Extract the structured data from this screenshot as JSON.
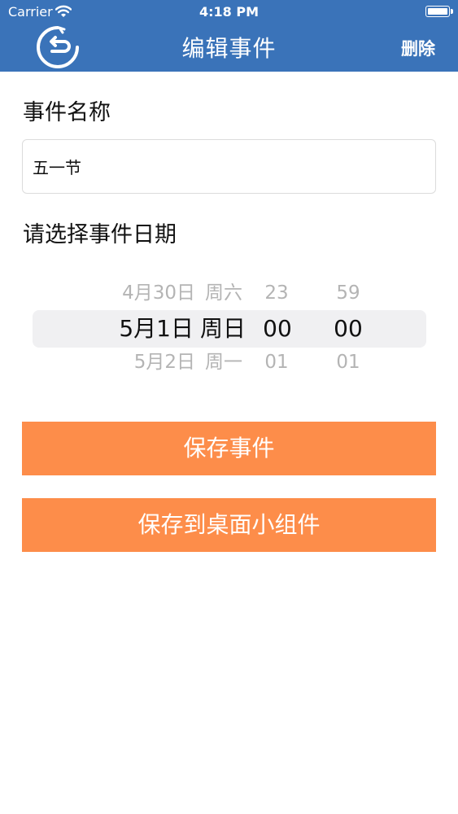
{
  "status_bar": {
    "carrier": "Carrier",
    "time": "4:18 PM"
  },
  "nav": {
    "title": "编辑事件",
    "delete_label": "删除",
    "back_icon": "back-arrow-icon"
  },
  "form": {
    "name_label": "事件名称",
    "name_value": "五一节",
    "date_label": "请选择事件日期"
  },
  "picker": {
    "above": {
      "date": "4月30日",
      "weekday": "周六",
      "hour": "23",
      "minute": "59"
    },
    "selected": {
      "date": "5月1日",
      "weekday": "周日",
      "hour": "00",
      "minute": "00"
    },
    "below": {
      "date": "5月2日",
      "weekday": "周一",
      "hour": "01",
      "minute": "01"
    }
  },
  "buttons": {
    "save_label": "保存事件",
    "save_widget_label": "保存到桌面小组件"
  },
  "colors": {
    "header": "#3a73b9",
    "button": "#fd8d4a"
  }
}
